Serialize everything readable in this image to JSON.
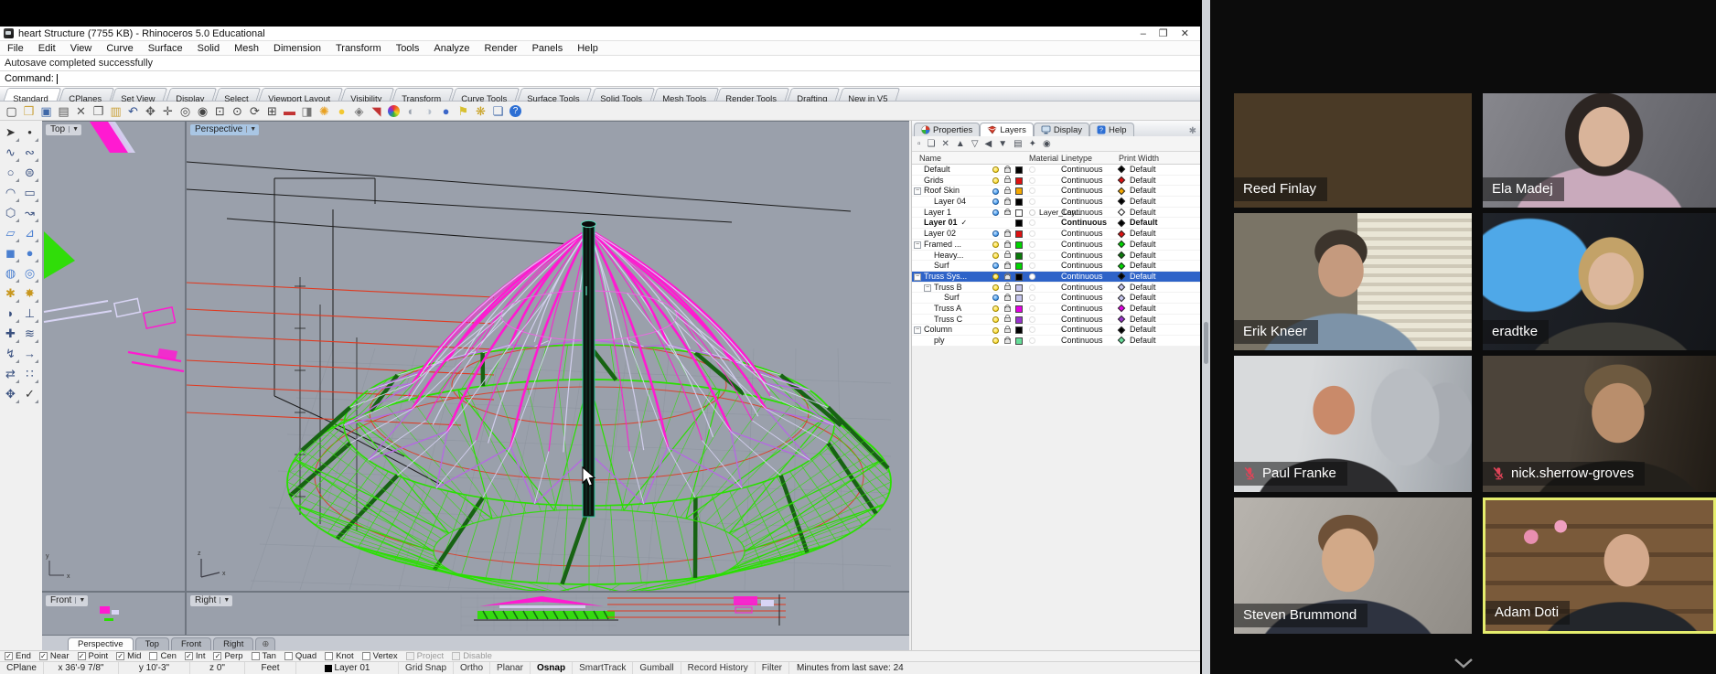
{
  "window": {
    "title": "heart Structure (7755 KB) - Rhinoceros 5.0 Educational",
    "controls": [
      "minimize",
      "restore",
      "close"
    ]
  },
  "menus": [
    "File",
    "Edit",
    "View",
    "Curve",
    "Surface",
    "Solid",
    "Mesh",
    "Dimension",
    "Transform",
    "Tools",
    "Analyze",
    "Render",
    "Panels",
    "Help"
  ],
  "command": {
    "history": "Autosave completed successfully",
    "prompt": "Command:"
  },
  "toolbar_tabs": [
    "Standard",
    "CPlanes",
    "Set View",
    "Display",
    "Select",
    "Viewport Layout",
    "Visibility",
    "Transform",
    "Curve Tools",
    "Surface Tools",
    "Solid Tools",
    "Mesh Tools",
    "Render Tools",
    "Drafting",
    "New in V5"
  ],
  "toolbar_active_tab": "Standard",
  "standard_icons": [
    {
      "name": "new-file-icon",
      "glyph": "▢",
      "color": "#444"
    },
    {
      "name": "open-file-icon",
      "glyph": "❒",
      "color": "#caa23c"
    },
    {
      "name": "save-icon",
      "glyph": "▣",
      "color": "#3f68a8"
    },
    {
      "name": "print-icon",
      "glyph": "▤",
      "color": "#555"
    },
    {
      "name": "cut-icon",
      "glyph": "✕",
      "color": "#555"
    },
    {
      "name": "copy-icon",
      "glyph": "❐",
      "color": "#555"
    },
    {
      "name": "paste-icon",
      "glyph": "▥",
      "color": "#caa23c"
    },
    {
      "name": "undo-icon",
      "glyph": "↶",
      "color": "#2f4f8f"
    },
    {
      "name": "pan-icon",
      "glyph": "✥",
      "color": "#555"
    },
    {
      "name": "move-icon",
      "glyph": "✛",
      "color": "#555"
    },
    {
      "name": "zoom-icon",
      "glyph": "◎",
      "color": "#444"
    },
    {
      "name": "zoom-dynamic-icon",
      "glyph": "◉",
      "color": "#444"
    },
    {
      "name": "zoom-window-icon",
      "glyph": "⊡",
      "color": "#444"
    },
    {
      "name": "zoom-selected-icon",
      "glyph": "⊙",
      "color": "#444"
    },
    {
      "name": "rotate-view-icon",
      "glyph": "⟳",
      "color": "#444"
    },
    {
      "name": "viewport-layout-icon",
      "glyph": "⊞",
      "color": "#444"
    },
    {
      "name": "render-icon",
      "glyph": "▬",
      "color": "#c23333"
    },
    {
      "name": "render-preview-icon",
      "glyph": "◨",
      "color": "#777"
    },
    {
      "name": "sun-icon",
      "glyph": "✺",
      "color": "#e8a020"
    },
    {
      "name": "lamp-icon",
      "glyph": "●",
      "color": "#f2c832"
    },
    {
      "name": "lock-icon",
      "glyph": "◈",
      "color": "#777"
    },
    {
      "name": "rhino-logo-icon",
      "glyph": "◥",
      "color": "#c23333"
    },
    {
      "name": "color-wheel-icon",
      "glyph": "",
      "color": ""
    },
    {
      "name": "shaded-mode-icon",
      "glyph": "◐",
      "color": "#9aa2ae"
    },
    {
      "name": "ghosted-mode-icon",
      "glyph": "◑",
      "color": "#b8c0cc"
    },
    {
      "name": "rendered-mode-icon",
      "glyph": "●",
      "color": "#3b66c8"
    },
    {
      "name": "flag-icon",
      "glyph": "⚑",
      "color": "#d8c030"
    },
    {
      "name": "gear-icon",
      "glyph": "❋",
      "color": "#c8a020"
    },
    {
      "name": "window-cascade-icon",
      "glyph": "❏",
      "color": "#3f68a8"
    },
    {
      "name": "help-icon",
      "glyph": "?",
      "color": "#fff"
    }
  ],
  "tool_palette": [
    {
      "name": "pointer-tool",
      "glyph": "➤",
      "color": "#333"
    },
    {
      "name": "point-tool",
      "glyph": "•",
      "color": "#333"
    },
    {
      "name": "polyline-tool",
      "glyph": "∿",
      "color": "#39507f"
    },
    {
      "name": "control-curve-tool",
      "glyph": "∾",
      "color": "#39507f"
    },
    {
      "name": "circle-tool",
      "glyph": "○",
      "color": "#39507f"
    },
    {
      "name": "ellipse-tool",
      "glyph": "⊜",
      "color": "#39507f"
    },
    {
      "name": "arc-tool",
      "glyph": "◠",
      "color": "#39507f"
    },
    {
      "name": "rectangle-tool",
      "glyph": "▭",
      "color": "#39507f"
    },
    {
      "name": "polygon-tool",
      "glyph": "⬡",
      "color": "#39507f"
    },
    {
      "name": "freeform-curve-tool",
      "glyph": "↝",
      "color": "#39507f"
    },
    {
      "name": "surface-tool",
      "glyph": "▱",
      "color": "#4a7fd0"
    },
    {
      "name": "loft-tool",
      "glyph": "⊿",
      "color": "#4a7fd0"
    },
    {
      "name": "box-tool",
      "glyph": "◼",
      "color": "#4a7fd0"
    },
    {
      "name": "sphere-tool",
      "glyph": "●",
      "color": "#4a7fd0"
    },
    {
      "name": "torus-tool",
      "glyph": "◍",
      "color": "#4a7fd0"
    },
    {
      "name": "pipe-tool",
      "glyph": "◎",
      "color": "#4a7fd0"
    },
    {
      "name": "boolean-tool",
      "glyph": "✱",
      "color": "#c8971e"
    },
    {
      "name": "explode-tool",
      "glyph": "✸",
      "color": "#c8971e"
    },
    {
      "name": "trim-tool",
      "glyph": "◗",
      "color": "#39507f"
    },
    {
      "name": "split-tool",
      "glyph": "⊥",
      "color": "#39507f"
    },
    {
      "name": "fillet-tool",
      "glyph": "✚",
      "color": "#39507f"
    },
    {
      "name": "offset-tool",
      "glyph": "≋",
      "color": "#39507f"
    },
    {
      "name": "curve-from-object-tool",
      "glyph": "↯",
      "color": "#39507f"
    },
    {
      "name": "extend-tool",
      "glyph": "→",
      "color": "#39507f"
    },
    {
      "name": "transform-tool",
      "glyph": "⇄",
      "color": "#39507f"
    },
    {
      "name": "array-tool",
      "glyph": "∷",
      "color": "#39507f"
    },
    {
      "name": "gumball-tool",
      "glyph": "✥",
      "color": "#39507f"
    },
    {
      "name": "check-tool",
      "glyph": "✓",
      "color": "#333"
    }
  ],
  "viewports": {
    "top": "Top",
    "perspective": "Perspective",
    "front": "Front",
    "right": "Right"
  },
  "viewport_tabs": [
    "Perspective",
    "Top",
    "Front",
    "Right"
  ],
  "panel": {
    "tabs": [
      {
        "label": "Properties",
        "icon": "properties-icon"
      },
      {
        "label": "Layers",
        "icon": "layers-icon"
      },
      {
        "label": "Display",
        "icon": "display-icon"
      },
      {
        "label": "Help",
        "icon": "help-icon"
      }
    ],
    "active": "Layers",
    "toolbar_icons": [
      {
        "name": "new-layer-icon",
        "glyph": "▫"
      },
      {
        "name": "copy-layer-icon",
        "glyph": "❏"
      },
      {
        "name": "delete-layer-icon",
        "glyph": "✕"
      },
      {
        "name": "move-up-icon",
        "glyph": "▲"
      },
      {
        "name": "move-down-icon",
        "glyph": "▽"
      },
      {
        "name": "collapse-icon",
        "glyph": "◀"
      },
      {
        "name": "filter-icon",
        "glyph": "▼"
      },
      {
        "name": "match-layer-icon",
        "glyph": "▤"
      },
      {
        "name": "layer-tools-icon",
        "glyph": "✦"
      },
      {
        "name": "layer-help-icon",
        "glyph": "◉"
      }
    ],
    "columns": [
      "Name",
      "Material",
      "Linetype",
      "Print Width"
    ],
    "layers": [
      {
        "name": "Default",
        "pad": 13,
        "box": false,
        "bulb": "y",
        "lock": true,
        "swatch": "#000000",
        "linetype": "Continuous",
        "pw": "Default",
        "pwc": "#000000"
      },
      {
        "name": "Grids",
        "pad": 13,
        "box": false,
        "bulb": "y",
        "lock": true,
        "swatch": "#dd1111",
        "linetype": "Continuous",
        "pw": "Default",
        "pwc": "#dd1111"
      },
      {
        "name": "Roof Skin",
        "pad": 2,
        "box": true,
        "bulb": "b",
        "lock": true,
        "swatch": "#f5a800",
        "linetype": "Continuous",
        "pw": "Default",
        "pwc": "#f5a800"
      },
      {
        "name": "Layer 04",
        "pad": 24,
        "box": false,
        "bulb": "b",
        "lock": true,
        "swatch": "#000000",
        "linetype": "Continuous",
        "pw": "Default",
        "pwc": "#000000"
      },
      {
        "name": "Layer 1",
        "pad": 13,
        "box": false,
        "bulb": "b",
        "lock": true,
        "swatch": "#ffffff",
        "material": "Layer_Lay...",
        "linetype": "Continuous",
        "pw": "Default",
        "pwc": "#ffffff"
      },
      {
        "name": "Layer 01",
        "pad": 13,
        "box": false,
        "bulb": null,
        "lock": false,
        "current": true,
        "bold": true,
        "swatch": "#000000",
        "linetype": "Continuous",
        "pw": "Default",
        "pwc": "#000000"
      },
      {
        "name": "Layer 02",
        "pad": 13,
        "box": false,
        "bulb": "b",
        "lock": true,
        "swatch": "#dd1111",
        "linetype": "Continuous",
        "pw": "Default",
        "pwc": "#dd1111"
      },
      {
        "name": "Framed ...",
        "pad": 2,
        "box": true,
        "bulb": "y",
        "lock": true,
        "swatch": "#00d400",
        "linetype": "Continuous",
        "pw": "Default",
        "pwc": "#00d400"
      },
      {
        "name": "Heavy...",
        "pad": 24,
        "box": false,
        "bulb": "y",
        "lock": true,
        "swatch": "#0a7a0a",
        "linetype": "Continuous",
        "pw": "Default",
        "pwc": "#0a7a0a"
      },
      {
        "name": "Surf",
        "pad": 24,
        "box": false,
        "bulb": "b",
        "lock": true,
        "swatch": "#00d400",
        "linetype": "Continuous",
        "pw": "Default",
        "pwc": "#00d400"
      },
      {
        "name": "Truss Sys...",
        "pad": 2,
        "box": true,
        "selected": true,
        "bulb": "y",
        "lock": true,
        "swatch": "#000000",
        "material": "dot",
        "linetype": "Continuous",
        "pw": "Default",
        "pwc": "#000000"
      },
      {
        "name": "Truss B",
        "pad": 13,
        "box": true,
        "bulb": "y",
        "lock": true,
        "swatch": "#c6c6ee",
        "linetype": "Continuous",
        "pw": "Default",
        "pwc": "#c6c6ee"
      },
      {
        "name": "Surf",
        "pad": 35,
        "box": false,
        "bulb": "b",
        "lock": true,
        "swatch": "#c6c6ee",
        "linetype": "Continuous",
        "pw": "Default",
        "pwc": "#c6c6ee"
      },
      {
        "name": "Truss A",
        "pad": 24,
        "box": false,
        "bulb": "y",
        "lock": true,
        "swatch": "#e400e4",
        "linetype": "Continuous",
        "pw": "Default",
        "pwc": "#e400e4"
      },
      {
        "name": "Truss C",
        "pad": 24,
        "box": false,
        "bulb": "y",
        "lock": true,
        "swatch": "#9933cc",
        "linetype": "Continuous",
        "pw": "Default",
        "pwc": "#9933cc"
      },
      {
        "name": "Column",
        "pad": 2,
        "box": true,
        "bulb": "y",
        "lock": true,
        "swatch": "#000000",
        "linetype": "Continuous",
        "pw": "Default",
        "pwc": "#000000"
      },
      {
        "name": "ply",
        "pad": 24,
        "box": false,
        "bulb": "y",
        "lock": true,
        "swatch": "#66dd99",
        "linetype": "Continuous",
        "pw": "Default",
        "pwc": "#66dd99"
      }
    ]
  },
  "osnap": [
    {
      "label": "End",
      "checked": true
    },
    {
      "label": "Near",
      "checked": true
    },
    {
      "label": "Point",
      "checked": true
    },
    {
      "label": "Mid",
      "checked": true
    },
    {
      "label": "Cen",
      "checked": false
    },
    {
      "label": "Int",
      "checked": true
    },
    {
      "label": "Perp",
      "checked": true
    },
    {
      "label": "Tan",
      "checked": false
    },
    {
      "label": "Quad",
      "checked": false
    },
    {
      "label": "Knot",
      "checked": false
    },
    {
      "label": "Vertex",
      "checked": false
    },
    {
      "label": "Project",
      "checked": false,
      "disabled": true
    },
    {
      "label": "Disable",
      "checked": false,
      "disabled": true
    }
  ],
  "status_bar": {
    "cells": [
      "CPlane",
      "x 36'-9 7/8\"",
      "y 10'-3\"",
      "z 0\"",
      "Feet",
      "Layer 01"
    ],
    "layer_swatch": "#000000",
    "toggles": [
      "Grid Snap",
      "Ortho",
      "Planar",
      "Osnap",
      "SmartTrack",
      "Gumball",
      "Record History",
      "Filter"
    ],
    "active_toggle": "Osnap",
    "message": "Minutes from last save: 24"
  },
  "meeting": {
    "participants": [
      {
        "name": "Reed Finlay",
        "muted": false,
        "active": false,
        "scene": "reed"
      },
      {
        "name": "Ela Madej",
        "muted": false,
        "active": false,
        "scene": "ela"
      },
      {
        "name": "Erik Kneer",
        "muted": false,
        "active": false,
        "scene": "erik"
      },
      {
        "name": "eradtke",
        "muted": false,
        "active": false,
        "scene": "eradtke"
      },
      {
        "name": "Paul Franke",
        "muted": true,
        "active": false,
        "scene": "paul"
      },
      {
        "name": "nick.sherrow-groves",
        "muted": true,
        "active": false,
        "scene": "nick"
      },
      {
        "name": "Steven Brummond",
        "muted": false,
        "active": false,
        "scene": "steven"
      },
      {
        "name": "Adam Doti",
        "muted": false,
        "active": true,
        "scene": "adam"
      }
    ]
  },
  "theme": {
    "viewport_bg": "#9aa0ab",
    "model_green": "#2ae000",
    "model_dark_green": "#176313",
    "model_magenta": "#ff1ad1",
    "model_lavender": "#d8d4f4",
    "model_purple": "#b46ae0",
    "model_red": "#e0391f",
    "construction_black": "#1a1a1a",
    "grid_line": "#8e95a0",
    "selection_blue": "#2e63c8",
    "active_speaker_border": "#e5ed6d",
    "muted_red": "#e04458",
    "mast_teal": "#2dc9a0"
  }
}
